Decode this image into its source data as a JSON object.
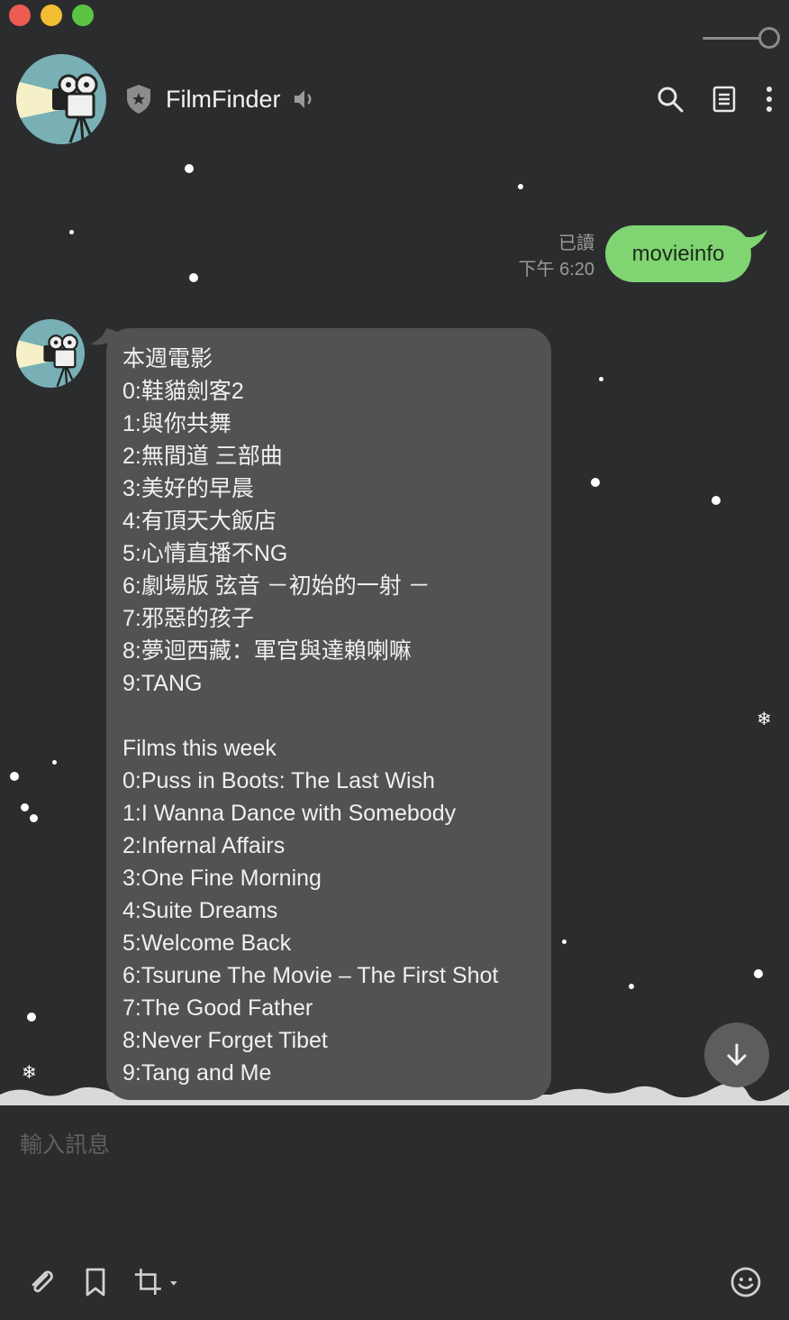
{
  "window": {
    "controls": [
      "close",
      "minimize",
      "zoom"
    ]
  },
  "header": {
    "title": "FilmFinder",
    "icons": [
      "shield-star-icon",
      "speaker-icon",
      "search-icon",
      "notes-icon",
      "more-vertical-icon"
    ]
  },
  "messages": {
    "outgoing": {
      "text": "movieinfo",
      "read_status": "已讀",
      "time": "下午 6:20"
    },
    "incoming": {
      "lines": [
        "本週電影",
        "0:鞋貓劍客2",
        "1:與你共舞",
        "2:無間道 三部曲",
        "3:美好的早晨",
        "4:有頂天大飯店",
        "5:心情直播不NG",
        "6:劇場版 弦音 －初始的一射 －",
        "7:邪惡的孩子",
        "8:夢迴西藏：軍官與達賴喇嘛",
        "9:TANG",
        "",
        "Films this week",
        "0:Puss in Boots: The Last Wish",
        "1:I Wanna Dance with Somebody",
        "2:Infernal Affairs",
        "3:One Fine Morning",
        "4:Suite Dreams",
        "5:Welcome Back",
        "6:Tsurune The Movie – The First Shot",
        "7:The Good Father",
        "8:Never Forget Tibet",
        "9:Tang and Me"
      ]
    }
  },
  "composer": {
    "placeholder": "輸入訊息",
    "tools": [
      "paperclip-icon",
      "bookmark-icon",
      "crop-icon",
      "emoji-icon"
    ]
  },
  "colors": {
    "background": "#2b2c2e",
    "outgoing_bubble": "#80d572",
    "incoming_bubble": "#525252",
    "avatar_bg": "#78b0b5"
  }
}
